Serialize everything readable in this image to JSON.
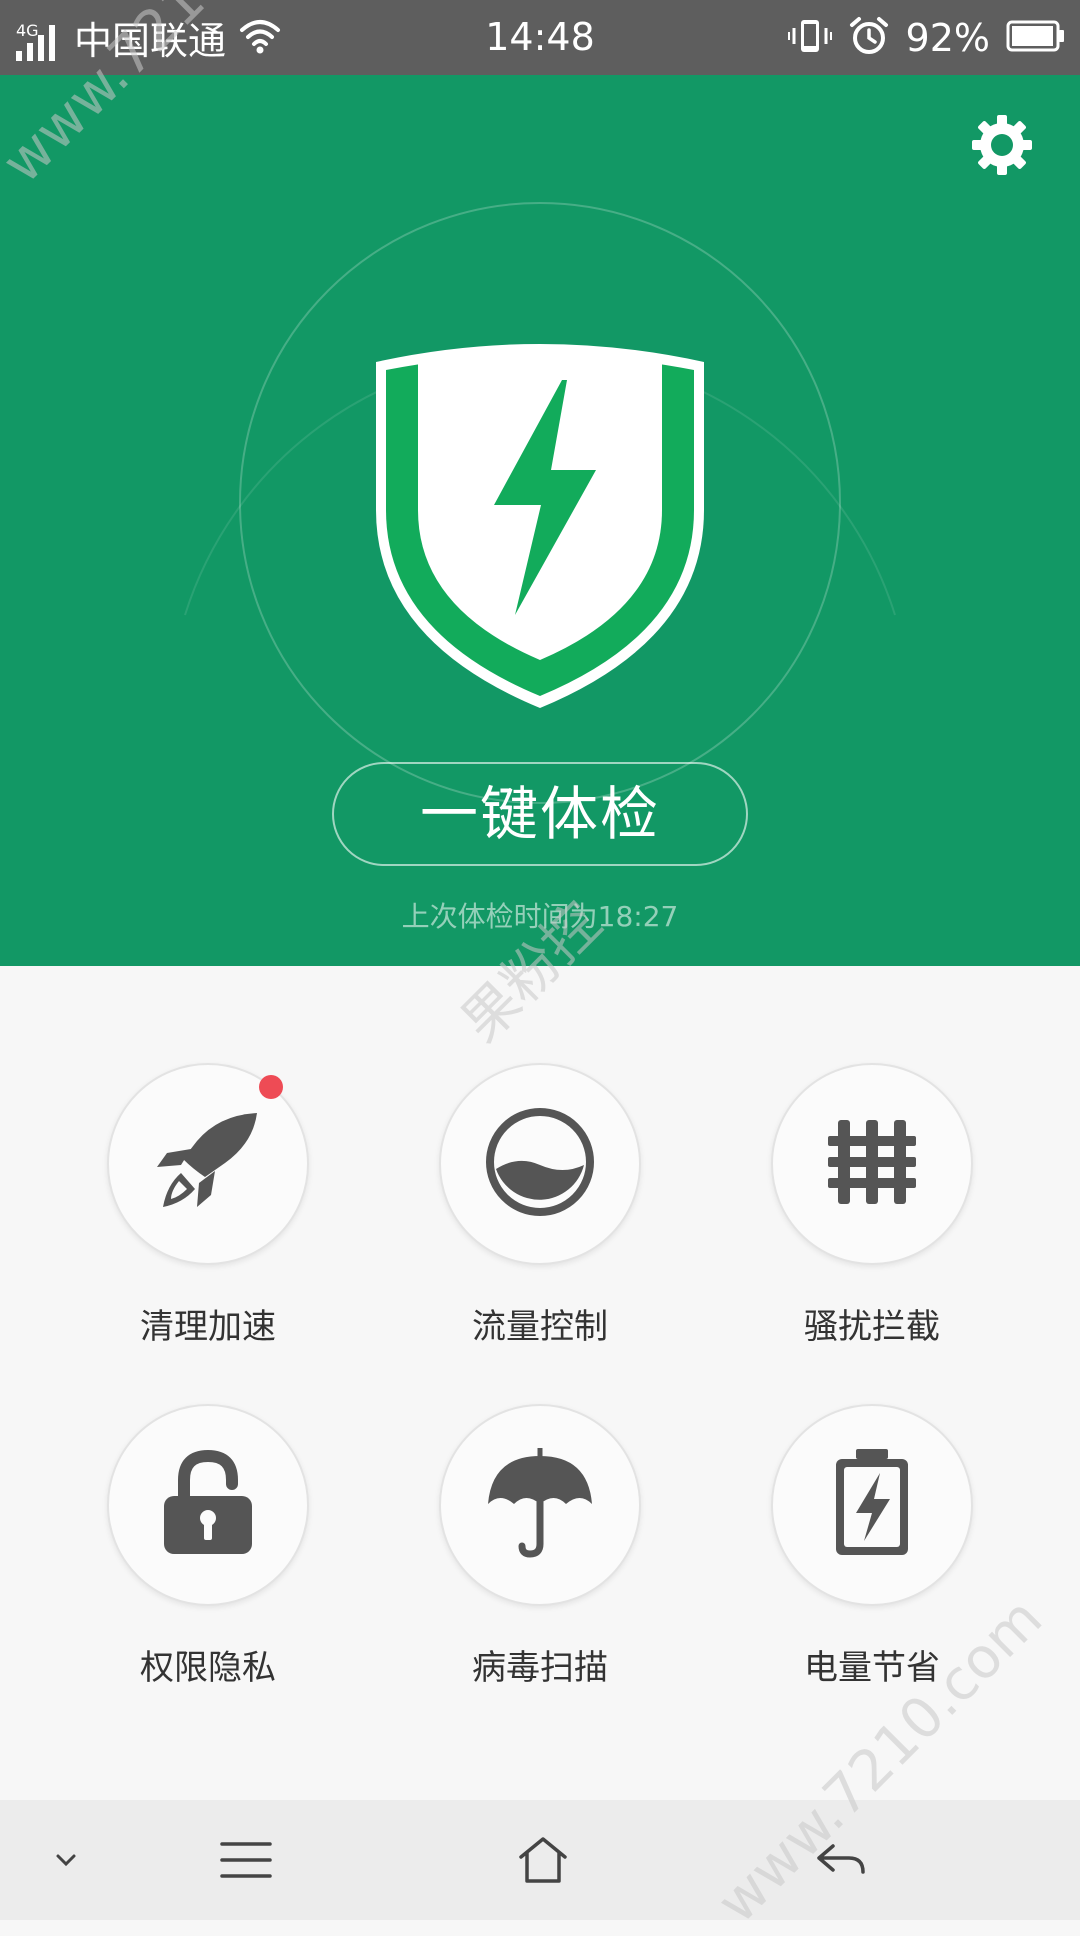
{
  "status_bar": {
    "network_type": "4G",
    "carrier": "中国联通",
    "time": "14:48",
    "battery": "92%"
  },
  "hero": {
    "scan_button": "一键体检",
    "last_check": "上次体检时间为18:27"
  },
  "features": [
    {
      "label": "清理加速",
      "icon": "rocket-icon",
      "badge": true
    },
    {
      "label": "流量控制",
      "icon": "data-gauge-icon",
      "badge": false
    },
    {
      "label": "骚扰拦截",
      "icon": "fence-icon",
      "badge": false
    },
    {
      "label": "权限隐私",
      "icon": "lock-icon",
      "badge": false
    },
    {
      "label": "病毒扫描",
      "icon": "umbrella-icon",
      "badge": false
    },
    {
      "label": "电量节省",
      "icon": "battery-icon",
      "badge": false
    }
  ],
  "nav": {
    "items": [
      "chevron-down-icon",
      "menu-icon",
      "home-icon",
      "back-icon"
    ]
  },
  "watermark": {
    "site": "www.7210.com",
    "text": "果粉控"
  },
  "colors": {
    "primary_green": "#129865",
    "badge_red": "#ee4b55",
    "icon_gray": "#555555"
  }
}
